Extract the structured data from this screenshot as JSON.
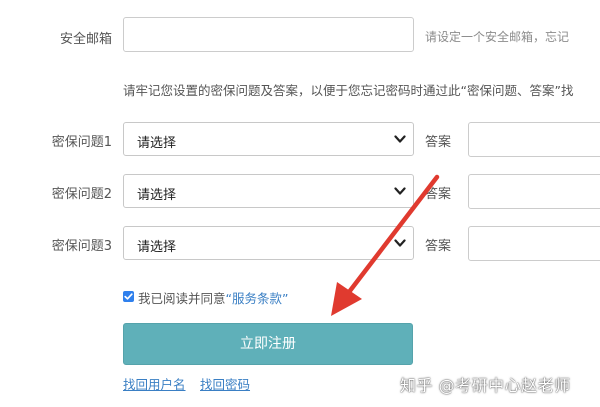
{
  "form": {
    "email": {
      "label": "安全邮箱",
      "value": "",
      "hint": "请设定一个安全邮箱，忘记"
    },
    "note": "请牢记您设置的密保问题及答案，以便于您忘记密码时通过此“密保问题、答案”找",
    "questions": [
      {
        "label": "密保问题1",
        "selected": "请选择",
        "answer_label": "答案",
        "answer_value": ""
      },
      {
        "label": "密保问题2",
        "selected": "请选择",
        "answer_label": "答案",
        "answer_value": ""
      },
      {
        "label": "密保问题3",
        "selected": "请选择",
        "answer_label": "答案",
        "answer_value": ""
      }
    ],
    "agree": {
      "text": "我已阅读并同意",
      "link": "“服务条款”",
      "checked": true
    },
    "submit_label": "立即注册",
    "bottom_links": [
      "找回用户名",
      "找回密码"
    ]
  },
  "watermark": "知乎 @考研中心赵老师",
  "colors": {
    "button": "#5fb0b9",
    "link": "#3a7fc4",
    "checkbox": "#2f80ed",
    "arrow": "#e03a2f"
  },
  "icons": {
    "select_arrow": "chevron-down-icon",
    "checkbox": "checkmark-icon",
    "annotation": "red-arrow"
  }
}
